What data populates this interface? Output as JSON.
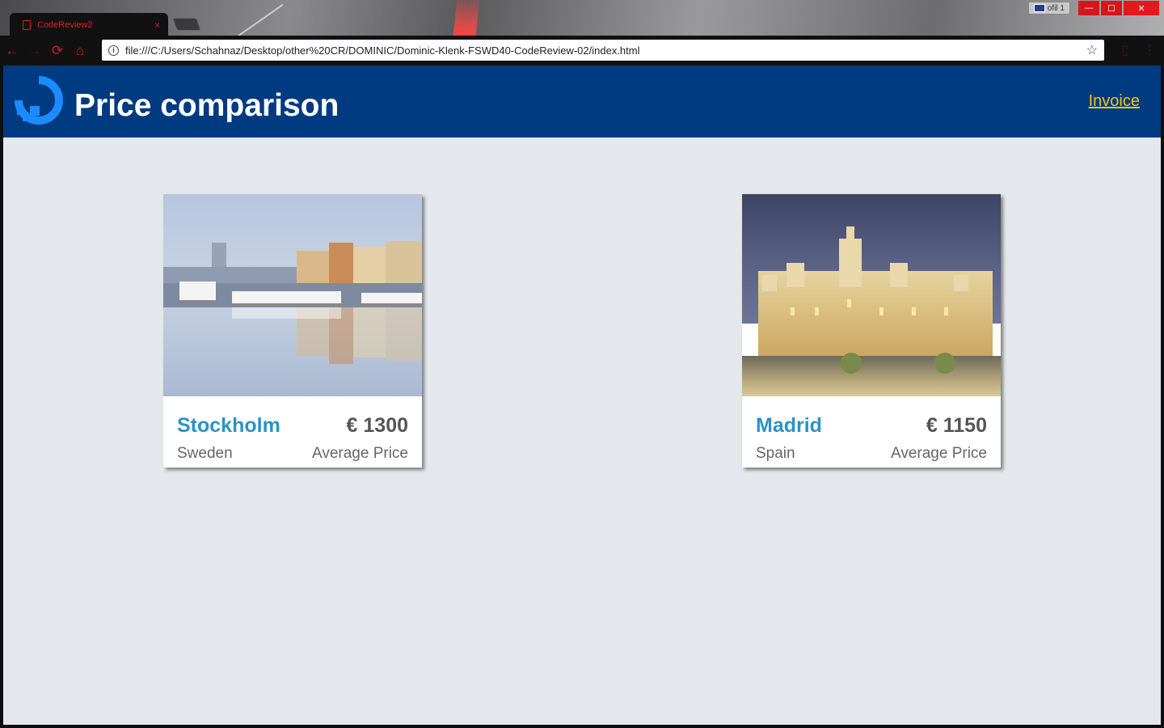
{
  "browser": {
    "tab_title": "CodeReview2",
    "tab_close": "×",
    "url": "file:///C:/Users/Schahnaz/Desktop/other%20CR/DOMINIC/Dominic-Klenk-FSWD40-CodeReview-02/index.html",
    "profile_label": "ofil 1",
    "icons": {
      "back": "←",
      "forward": "→",
      "reload": "⟳",
      "home": "⌂",
      "info": "i",
      "star": "☆",
      "bookmark": "▯",
      "menu": "⋮",
      "minimize": "—",
      "maximize": "☐",
      "close": "✕"
    },
    "accent_color": "#d71a1a"
  },
  "site": {
    "title": "Price comparison",
    "invoice_link": "Invoice",
    "header_color": "#003a80",
    "link_color": "#f0c419"
  },
  "cards": [
    {
      "city": "Stockholm",
      "price": "€ 1300",
      "country": "Sweden",
      "price_label": "Average Price"
    },
    {
      "city": "Madrid",
      "price": "€ 1150",
      "country": "Spain",
      "price_label": "Average Price"
    }
  ]
}
